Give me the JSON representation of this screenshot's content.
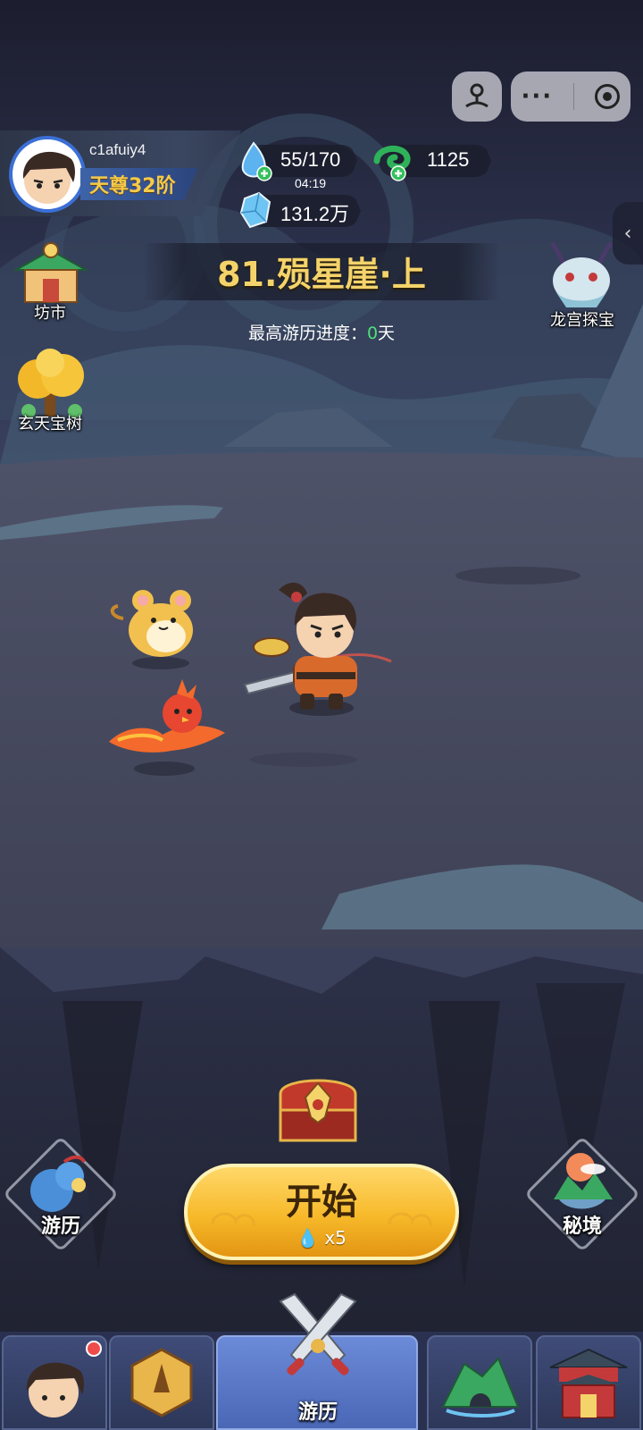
{
  "player": {
    "username": "c1afuiy4",
    "rank": "天尊32阶"
  },
  "resources": {
    "energy": "55/170",
    "energy_timer": "04:19",
    "jade": "1125",
    "crystal": "131.2万"
  },
  "stage": {
    "title": "81.殒星崖·上",
    "progress_label": "最高游历进度：",
    "progress_value": "0",
    "progress_unit": "天"
  },
  "side_left": [
    {
      "label": "坊市",
      "icon": "market-pavilion-icon"
    },
    {
      "label": "玄天宝树",
      "icon": "golden-tree-icon"
    }
  ],
  "side_right": [
    {
      "label": "龙宫探宝",
      "icon": "dragon-head-icon"
    }
  ],
  "start": {
    "label": "开始",
    "cost": "x5"
  },
  "bottom_actions": {
    "left_label": "游历",
    "right_label": "秘境"
  },
  "nav": [
    {
      "label": "",
      "icon": "character-portrait-icon",
      "badge": true
    },
    {
      "label": "",
      "icon": "praying-hands-icon"
    },
    {
      "label": "游历",
      "icon": "crossed-swords-icon",
      "active": true
    },
    {
      "label": "",
      "icon": "mountain-cave-icon"
    },
    {
      "label": "",
      "icon": "palace-gate-icon"
    }
  ],
  "colors": {
    "gold": "#f4d36a",
    "rank_gold": "#f5c94a",
    "progress_green": "#4fe07a",
    "nav_active": "#5b78c8"
  }
}
